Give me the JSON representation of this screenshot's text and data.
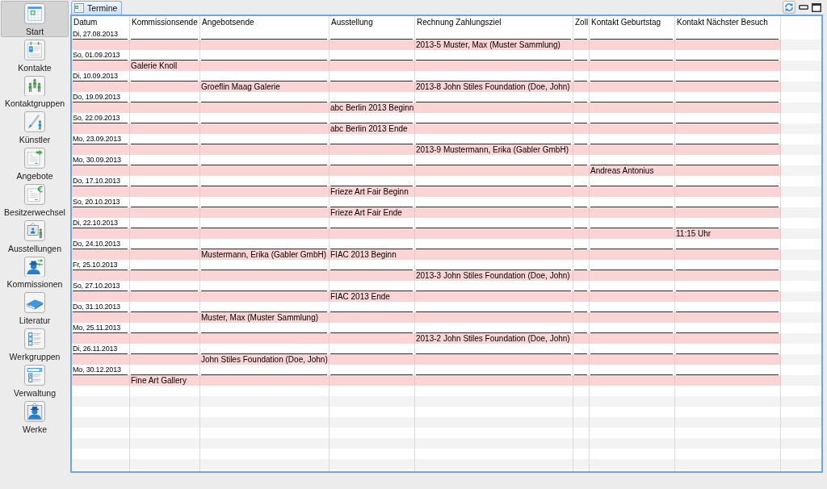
{
  "sidebar": {
    "items": [
      {
        "label": "Start",
        "selected": true
      },
      {
        "label": "Kontakte",
        "selected": false
      },
      {
        "label": "Kontaktgruppen",
        "selected": false
      },
      {
        "label": "Künstler",
        "selected": false
      },
      {
        "label": "Angebote",
        "selected": false
      },
      {
        "label": "Besitzerwechsel",
        "selected": false
      },
      {
        "label": "Ausstellungen",
        "selected": false
      },
      {
        "label": "Kommissionen",
        "selected": false
      },
      {
        "label": "Literatur",
        "selected": false
      },
      {
        "label": "Werkgruppen",
        "selected": false
      },
      {
        "label": "Verwaltung",
        "selected": false
      },
      {
        "label": "Werke",
        "selected": false
      }
    ]
  },
  "tabs": [
    {
      "label": "Termine",
      "selected": true
    }
  ],
  "table": {
    "columns": [
      "Datum",
      "Kommissionsende",
      "Angebotsende",
      "Ausstellung",
      "Rechnung Zahlungsziel",
      "Zoll",
      "Kontakt Geburtstag",
      "Kontakt Nächster Besuch"
    ],
    "rows": [
      {
        "date": "Di, 27.08.2013",
        "rechnung_zahlungsziel": "2013-5 Muster, Max (Muster Sammlung)"
      },
      {
        "date": "So, 01.09.2013",
        "kommissionsende": "Galerie Knoll"
      },
      {
        "date": "Di, 10.09.2013",
        "angebotsende": "Groeflin Maag Galerie",
        "rechnung_zahlungsziel": "2013-8 John Stiles Foundation (Doe, John)"
      },
      {
        "date": "Do, 19.09.2013",
        "ausstellung": "abc Berlin 2013 Beginn"
      },
      {
        "date": "So, 22.09.2013",
        "ausstellung": "abc Berlin 2013 Ende"
      },
      {
        "date": "Mo, 23.09.2013",
        "rechnung_zahlungsziel": "2013-9 Mustermann, Erika (Gabler GmbH)"
      },
      {
        "date": "Mo, 30.09.2013",
        "kontakt_geburtstag": "Andreas Antonius"
      },
      {
        "date": "Do, 17.10.2013",
        "ausstellung": "Frieze Art Fair Beginn"
      },
      {
        "date": "So, 20.10.2013",
        "ausstellung": "Frieze Art Fair Ende"
      },
      {
        "date": "Di, 22.10.2013",
        "kontakt_naechster_besuch": "11:15 Uhr"
      },
      {
        "date": "Do, 24.10.2013",
        "angebotsende": "Mustermann, Erika (Gabler GmbH)",
        "ausstellung": "FIAC 2013 Beginn"
      },
      {
        "date": "Fr, 25.10.2013",
        "rechnung_zahlungsziel": "2013-3 John Stiles Foundation (Doe, John)"
      },
      {
        "date": "So, 27.10.2013",
        "ausstellung": "FIAC 2013 Ende"
      },
      {
        "date": "Do, 31.10.2013",
        "angebotsende": "Muster, Max (Muster Sammlung)"
      },
      {
        "date": "Mo, 25.11.2013",
        "rechnung_zahlungsziel": "2013-2 John Stiles Foundation (Doe, John)"
      },
      {
        "date": "Di, 26.11.2013",
        "angebotsende": "John Stiles Foundation (Doe, John)"
      },
      {
        "date": "Mo, 30.12.2013",
        "kommissionsende": "Fine Art Gallery"
      }
    ]
  }
}
